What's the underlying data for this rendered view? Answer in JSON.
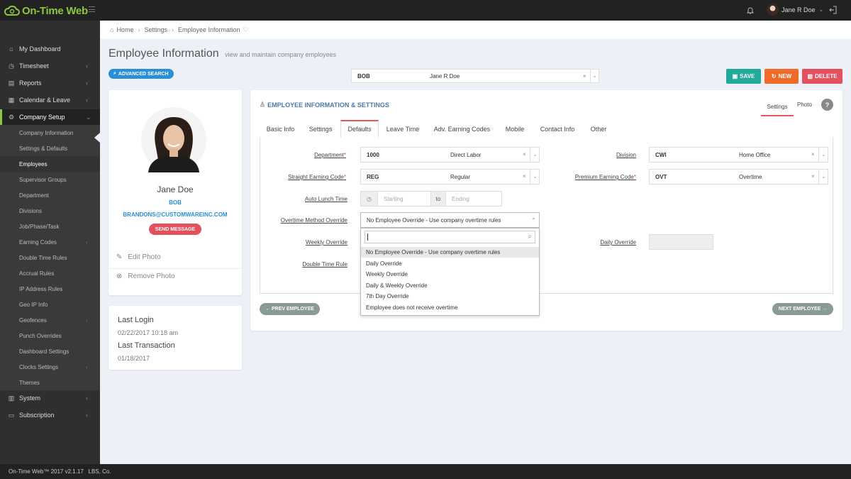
{
  "app": {
    "name": "On-Time Web",
    "user": "Jane R Doe"
  },
  "sidebar": {
    "items": [
      {
        "label": "My Dashboard",
        "icon": "home-icon"
      },
      {
        "label": "Timesheet",
        "icon": "clock-icon",
        "chevron": "‹"
      },
      {
        "label": "Reports",
        "icon": "report-icon",
        "chevron": "‹"
      },
      {
        "label": "Calendar & Leave",
        "icon": "calendar-icon",
        "chevron": "‹"
      },
      {
        "label": "Company Setup",
        "icon": "cogs-icon",
        "chevron": "⌄"
      }
    ],
    "sub_items": [
      {
        "label": "Company Information"
      },
      {
        "label": "Settings & Defaults"
      },
      {
        "label": "Employees"
      },
      {
        "label": "Supervisor Groups"
      },
      {
        "label": "Department"
      },
      {
        "label": "Divisions"
      },
      {
        "label": "Job/Phase/Task"
      },
      {
        "label": "Earning Codes",
        "chevron": "‹"
      },
      {
        "label": "Double Time Rules"
      },
      {
        "label": "Accrual Rules"
      },
      {
        "label": "IP Address Rules"
      },
      {
        "label": "Geo IP Info"
      },
      {
        "label": "Geofences",
        "chevron": "‹"
      },
      {
        "label": "Punch Overrides"
      },
      {
        "label": "Dashboard Settings"
      },
      {
        "label": "Clocks Settings",
        "chevron": "‹"
      },
      {
        "label": "Themes"
      }
    ],
    "bottom_items": [
      {
        "label": "System",
        "icon": "server-icon",
        "chevron": "‹"
      },
      {
        "label": "Subscription",
        "icon": "card-icon",
        "chevron": "‹"
      }
    ]
  },
  "breadcrumb": {
    "home": "Home",
    "settings": "Settings",
    "current": "Employee Information",
    "sep": "›",
    "heart": "♡"
  },
  "page": {
    "title": "Employee Information",
    "subtitle": "view and maintain company employees"
  },
  "advanced_search": "ADVANCED SEARCH",
  "employee_select": {
    "code": "BOB",
    "name": "Jane R Doe"
  },
  "actions": {
    "save": "SAVE",
    "new": "NEW",
    "delete": "DELETE"
  },
  "profile": {
    "name": "Jane Doe",
    "code": "BOB",
    "email": "BRANDONS@CUSTOMWAREINC.COM",
    "send_message": "SEND MESSAGE",
    "edit_photo": "Edit Photo",
    "remove_photo": "Remove Photo"
  },
  "login": {
    "last_login_label": "Last Login",
    "last_login_value": "02/22/2017 10:18 am",
    "last_txn_label": "Last Transaction",
    "last_txn_value": "01/18/2017"
  },
  "panel": {
    "title": "EMPLOYEE INFORMATION & SETTINGS",
    "tab_settings": "Settings",
    "tab_photo": "Photo",
    "help": "?"
  },
  "tabs": [
    "Basic Info",
    "Settings",
    "Defaults",
    "Leave Time",
    "Adv. Earning Codes",
    "Mobile",
    "Contact Info",
    "Other"
  ],
  "form": {
    "department": {
      "label": "Department",
      "code": "1000",
      "name": "Direct Labor"
    },
    "division": {
      "label": "Division",
      "code": "CWI",
      "name": "Home Office"
    },
    "straight": {
      "label": "Straight Earning Code",
      "code": "REG",
      "name": "Regular"
    },
    "premium": {
      "label": "Premium Earning Code",
      "code": "OVT",
      "name": "Overtime"
    },
    "auto_lunch": {
      "label": "Auto Lunch Time",
      "starting": "Starting",
      "to": "to",
      "ending": "Ending"
    },
    "overtime_method": {
      "label": "Overtime Method Override",
      "value": "No Employee Override - Use company overtime rules"
    },
    "weekly": {
      "label": "Weekly Override"
    },
    "daily": {
      "label": "Daily Override"
    },
    "double": {
      "label": "Double Time Rule"
    }
  },
  "dropdown": {
    "search_value": "",
    "options": [
      "No Employee Override - Use company overtime rules",
      "Daily Override",
      "Weekly Override",
      "Daily & Weekly Override",
      "7th Day Override",
      "Employee does not receive overtime"
    ]
  },
  "nav": {
    "prev": "← PREV EMPLOYEE",
    "next": "NEXT EMPLOYEE →"
  },
  "footer": {
    "text": "On-Time Web™ 2017 v2.1.17   LBS, Co."
  },
  "colors": {
    "brand_green": "#8cc63f",
    "accent_blue": "#2a8fd6",
    "save": "#21a99a",
    "new": "#f06a2a",
    "delete": "#e5505f",
    "tab_active": "#e35a5a"
  }
}
